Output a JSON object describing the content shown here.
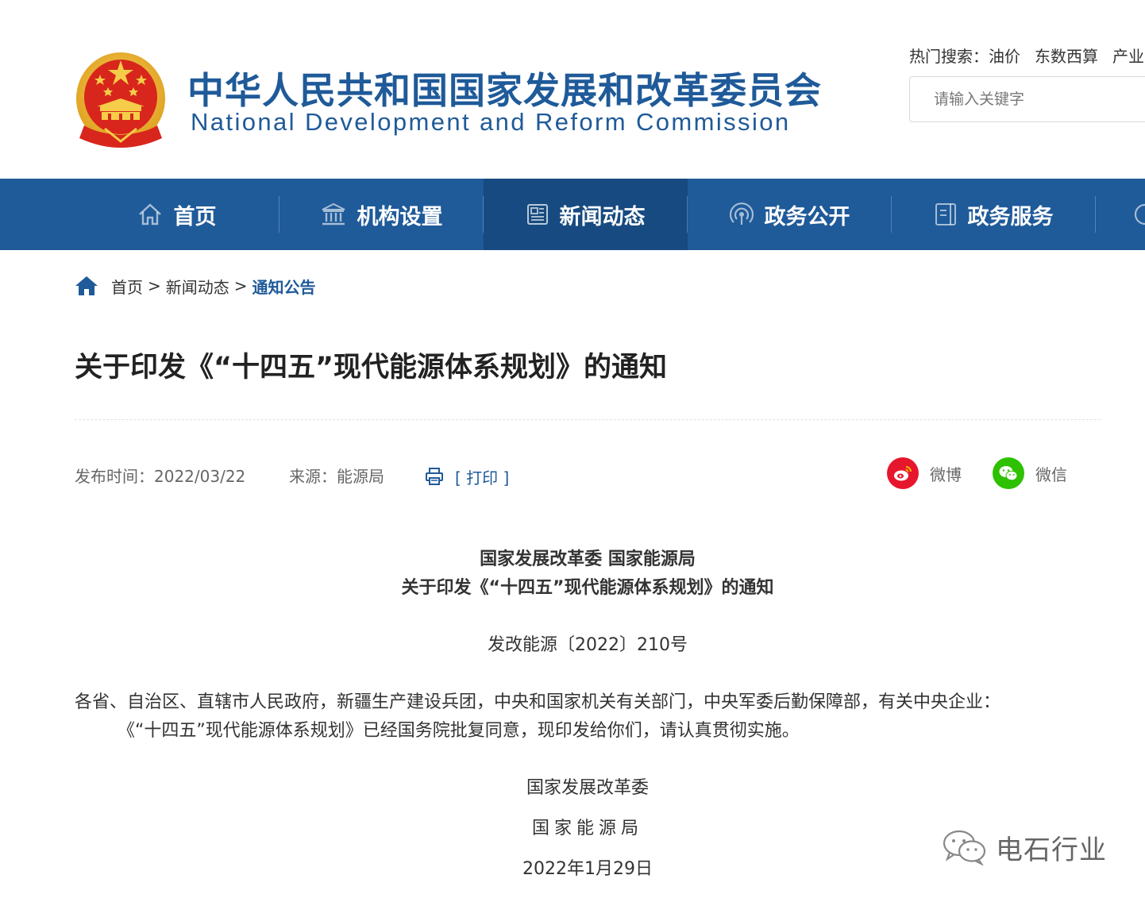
{
  "header": {
    "site_name_cn": "中华人民共和国国家发展和改革委员会",
    "site_name_en": "National Development and Reform Commission",
    "hot_search_label": "热门搜索：",
    "hot_search_terms": [
      "油价",
      "东数西算",
      "产业"
    ],
    "search_placeholder": "请输入关键字"
  },
  "nav": {
    "items": [
      {
        "label": "首页",
        "icon": "home-icon"
      },
      {
        "label": "机构设置",
        "icon": "institution-icon"
      },
      {
        "label": "新闻动态",
        "icon": "news-icon",
        "active": true
      },
      {
        "label": "政务公开",
        "icon": "broadcast-icon"
      },
      {
        "label": "政务服务",
        "icon": "service-icon"
      }
    ]
  },
  "breadcrumb": {
    "home": "首页",
    "separator": ">",
    "section": "新闻动态",
    "current": "通知公告"
  },
  "article": {
    "title": "关于印发《“十四五”现代能源体系规划》的通知",
    "publish_time": "发布时间：2022/03/22",
    "source": "来源：能源局",
    "print_label": "[ 打印 ]",
    "share": {
      "weibo_label": "微博",
      "wechat_label": "微信"
    },
    "doc_head_line1": "国家发展改革委 国家能源局",
    "doc_head_line2": "关于印发《“十四五”现代能源体系规划》的通知",
    "doc_number": "发改能源〔2022〕210号",
    "recipients": "各省、自治区、直辖市人民政府，新疆生产建设兵团，中央和国家机关有关部门，中央军委后勤保障部，有关中央企业：",
    "body": "《“十四五”现代能源体系规划》已经国务院批复同意，现印发给你们，请认真贯彻实施。",
    "signer_1": "国家发展改革委",
    "signer_2": "国家能源局",
    "sign_date": "2022年1月29日"
  },
  "watermark": {
    "text": "电石行业"
  },
  "colors": {
    "brand_blue": "#1f5a99",
    "nav_active": "#174a80",
    "weibo_red": "#e6162d",
    "wechat_green": "#2dc100"
  }
}
